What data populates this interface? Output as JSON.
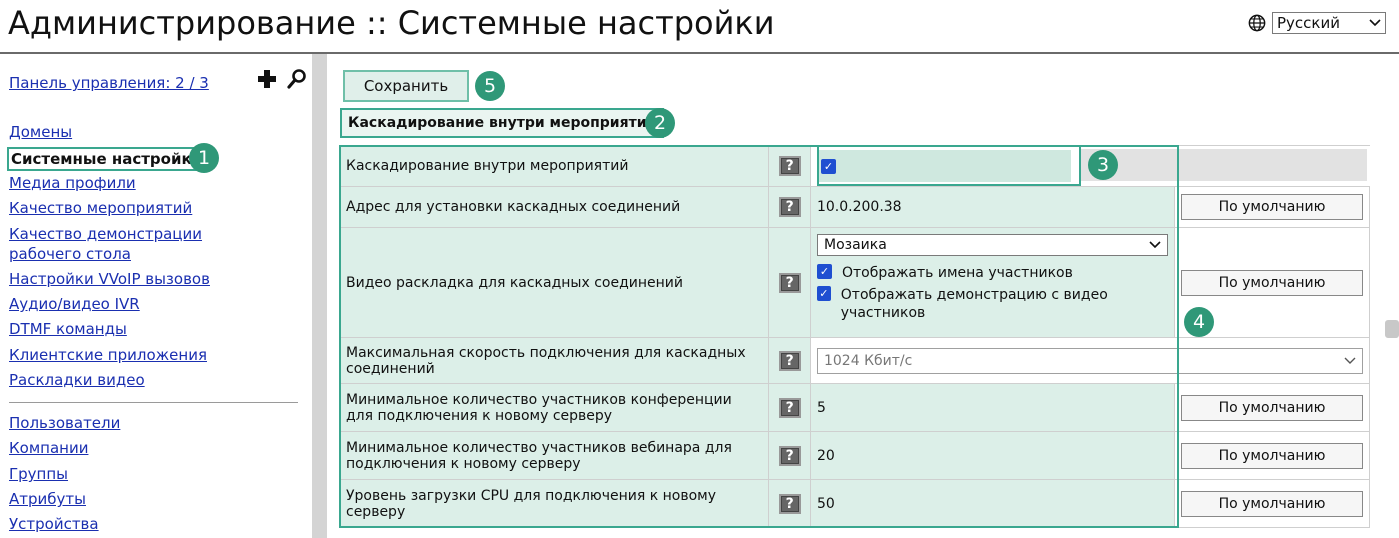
{
  "header": {
    "title": "Администрирование :: Системные настройки",
    "language": "Русский"
  },
  "sidebar": {
    "panel_link": "Панель управления: 2 / 3",
    "group1": [
      "Домены",
      "Системные настройки",
      "Медиа профили",
      "Качество мероприятий",
      "Качество демонстрации рабочего стола",
      "Настройки VVoIP вызовов",
      "Аудио/видео IVR",
      "DTMF команды",
      "Клиентские приложения",
      "Раскладки видео"
    ],
    "active_index": 1,
    "group2": [
      "Пользователи",
      "Компании",
      "Группы",
      "Атрибуты",
      "Устройства"
    ]
  },
  "main": {
    "save_label": "Сохранить",
    "section_title": "Каскадирование внутри мероприятий",
    "help_glyph": "?",
    "default_label": "По умолчанию",
    "rows": [
      {
        "label": "Каскадирование внутри мероприятий",
        "value_type": "checkbox",
        "checked": true
      },
      {
        "label": "Адрес для установки каскадных соединений",
        "value": "10.0.200.38"
      },
      {
        "label": "Видео раскладка для каскадных соединений",
        "select_value": "Мозаика",
        "options": [
          {
            "label": "Отображать имена участников",
            "checked": true
          },
          {
            "label": "Отображать демонстрацию с видео участников",
            "checked": true
          }
        ]
      },
      {
        "label": "Максимальная скорость подключения для каскадных соединений",
        "select_value": "1024 Кбит/с"
      },
      {
        "label": "Минимальное количество участников конференции для подключения к новому серверу",
        "value": "5"
      },
      {
        "label": "Минимальное количество участников вебинара для подключения к новому серверу",
        "value": "20"
      },
      {
        "label": "Уровень загрузки CPU для подключения к новому серверу",
        "value": "50"
      }
    ]
  },
  "badges": [
    "1",
    "2",
    "3",
    "4",
    "5"
  ],
  "colors": {
    "accent": "#2f9878",
    "highlight": "#dcefe8",
    "link": "#1a2fb0"
  }
}
